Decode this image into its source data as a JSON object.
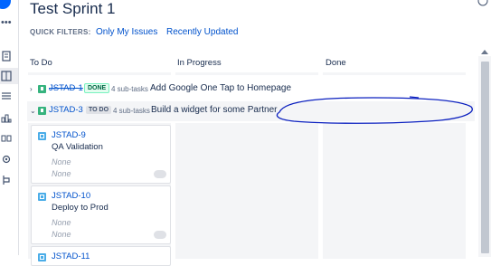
{
  "board": {
    "title": "Test Sprint 1",
    "quick_filters_label": "QUICK FILTERS:",
    "quick_filters": [
      "Only My Issues",
      "Recently Updated"
    ]
  },
  "columns": [
    "To Do",
    "In Progress",
    "Done"
  ],
  "swimlanes": [
    {
      "key": "JSTAD-1",
      "status": "DONE",
      "subtasks": "4 sub-tasks",
      "summary": "Add Google One Tap to Homepage",
      "expanded": false
    },
    {
      "key": "JSTAD-3",
      "status": "TO DO",
      "subtasks": "4 sub-tasks",
      "summary": "Build a widget for some Partner",
      "expanded": true
    }
  ],
  "cards": [
    {
      "key": "JSTAD-9",
      "summary": "QA Validation",
      "field1": "None",
      "field2": "None"
    },
    {
      "key": "JSTAD-10",
      "summary": "Deploy to Prod",
      "field1": "None",
      "field2": "None"
    },
    {
      "key": "JSTAD-11"
    }
  ],
  "colors": {
    "link": "#0052cc",
    "story_icon": "#36b37e",
    "subtask_icon": "#4bade8",
    "annotation_ink": "#0a1fbf"
  },
  "icons": [
    "avatar-icon",
    "more-icon",
    "backlog-icon",
    "board-icon",
    "releases-icon",
    "reports-icon",
    "components-icon",
    "settings-icon",
    "shortcut-icon",
    "help-icon"
  ]
}
